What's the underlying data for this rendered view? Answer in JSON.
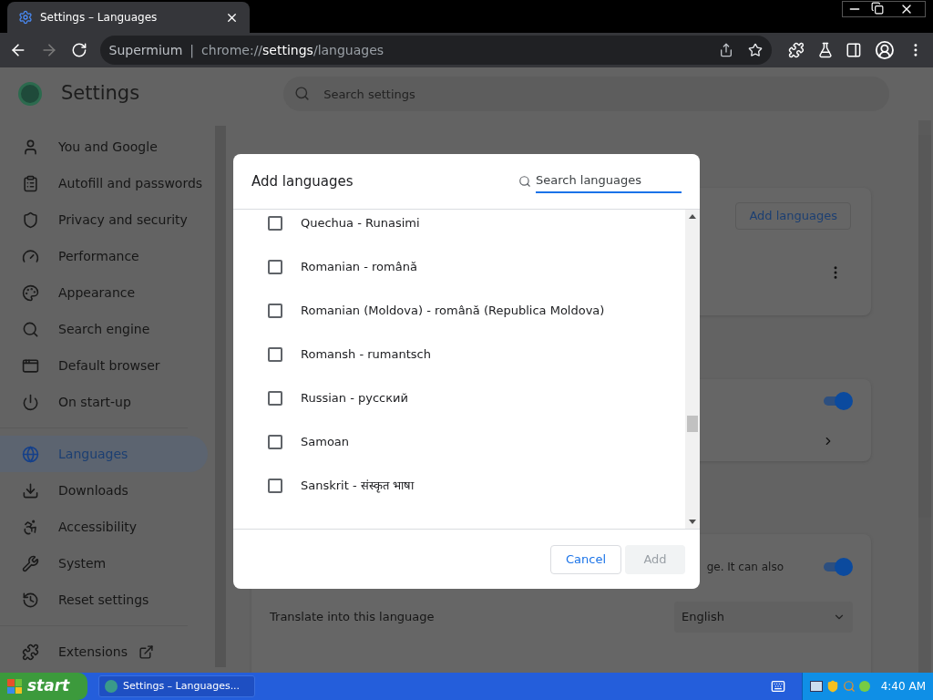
{
  "browser": {
    "tab": {
      "title": "Settings – Languages",
      "selected": true
    },
    "forward_disabled": true,
    "address": {
      "brand": "Supermium",
      "separator": "|",
      "scheme": "chrome://",
      "host": "settings",
      "path": "/languages"
    }
  },
  "settings": {
    "title": "Settings",
    "search_placeholder": "Search settings",
    "sidebar": [
      {
        "label": "You and Google",
        "selected": false
      },
      {
        "label": "Autofill and passwords",
        "selected": false
      },
      {
        "label": "Privacy and security",
        "selected": false
      },
      {
        "label": "Performance",
        "selected": false
      },
      {
        "label": "Appearance",
        "selected": false
      },
      {
        "label": "Search engine",
        "selected": false
      },
      {
        "label": "Default browser",
        "selected": false
      },
      {
        "label": "On start-up",
        "selected": false
      },
      {
        "label": "Languages",
        "selected": true
      },
      {
        "label": "Downloads",
        "selected": false
      },
      {
        "label": "Accessibility",
        "selected": false
      },
      {
        "label": "System",
        "selected": false
      },
      {
        "label": "Reset settings",
        "selected": false
      }
    ],
    "extensions": "Extensions",
    "add_languages_button": "Add languages",
    "toggles": [
      {
        "on": true
      },
      {
        "on": true
      }
    ],
    "partial_text": "ge. It can also",
    "translate_label": "Translate into this language",
    "translate_value": "English"
  },
  "dialog": {
    "title": "Add languages",
    "search_placeholder": "Search languages",
    "languages": [
      {
        "label": "Quechua - Runasimi",
        "checked": false
      },
      {
        "label": "Romanian - română",
        "checked": false
      },
      {
        "label": "Romanian (Moldova) - română (Republica Moldova)",
        "checked": false
      },
      {
        "label": "Romansh - rumantsch",
        "checked": false
      },
      {
        "label": "Russian - русский",
        "checked": false
      },
      {
        "label": "Samoan",
        "checked": false
      },
      {
        "label": "Sanskrit - संस्कृत भाषा",
        "checked": false
      }
    ],
    "cancel": "Cancel",
    "add": {
      "label": "Add",
      "disabled": true
    }
  },
  "taskbar": {
    "start": "start",
    "task": "Settings – Languages...",
    "clock": "4:40 AM"
  }
}
